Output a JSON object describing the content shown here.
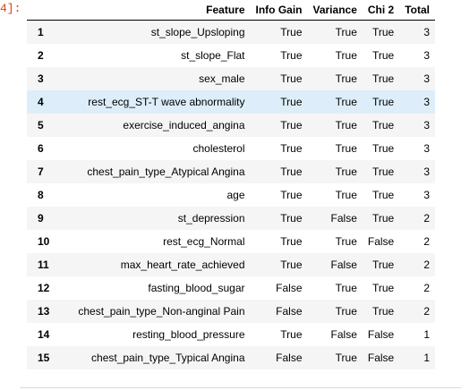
{
  "cell": {
    "prompt": "4]:"
  },
  "table": {
    "columns": [
      "",
      "Feature",
      "Info Gain",
      "Variance",
      "Chi 2",
      "Total"
    ],
    "rows": [
      {
        "index": "1",
        "feature": "st_slope_Upsloping",
        "info_gain": "True",
        "variance": "True",
        "chi2": "True",
        "total": "3"
      },
      {
        "index": "2",
        "feature": "st_slope_Flat",
        "info_gain": "True",
        "variance": "True",
        "chi2": "True",
        "total": "3"
      },
      {
        "index": "3",
        "feature": "sex_male",
        "info_gain": "True",
        "variance": "True",
        "chi2": "True",
        "total": "3"
      },
      {
        "index": "4",
        "feature": "rest_ecg_ST-T wave abnormality",
        "info_gain": "True",
        "variance": "True",
        "chi2": "True",
        "total": "3"
      },
      {
        "index": "5",
        "feature": "exercise_induced_angina",
        "info_gain": "True",
        "variance": "True",
        "chi2": "True",
        "total": "3"
      },
      {
        "index": "6",
        "feature": "cholesterol",
        "info_gain": "True",
        "variance": "True",
        "chi2": "True",
        "total": "3"
      },
      {
        "index": "7",
        "feature": "chest_pain_type_Atypical Angina",
        "info_gain": "True",
        "variance": "True",
        "chi2": "True",
        "total": "3"
      },
      {
        "index": "8",
        "feature": "age",
        "info_gain": "True",
        "variance": "True",
        "chi2": "True",
        "total": "3"
      },
      {
        "index": "9",
        "feature": "st_depression",
        "info_gain": "True",
        "variance": "False",
        "chi2": "True",
        "total": "2"
      },
      {
        "index": "10",
        "feature": "rest_ecg_Normal",
        "info_gain": "True",
        "variance": "True",
        "chi2": "False",
        "total": "2"
      },
      {
        "index": "11",
        "feature": "max_heart_rate_achieved",
        "info_gain": "True",
        "variance": "False",
        "chi2": "True",
        "total": "2"
      },
      {
        "index": "12",
        "feature": "fasting_blood_sugar",
        "info_gain": "False",
        "variance": "True",
        "chi2": "True",
        "total": "2"
      },
      {
        "index": "13",
        "feature": "chest_pain_type_Non-anginal Pain",
        "info_gain": "False",
        "variance": "True",
        "chi2": "True",
        "total": "2"
      },
      {
        "index": "14",
        "feature": "resting_blood_pressure",
        "info_gain": "True",
        "variance": "False",
        "chi2": "False",
        "total": "1"
      },
      {
        "index": "15",
        "feature": "chest_pain_type_Typical Angina",
        "info_gain": "False",
        "variance": "True",
        "chi2": "False",
        "total": "1"
      }
    ],
    "highlighted_row": 3,
    "colors": {
      "hover_row": "#ddeefa",
      "stripe": "#f5f5f5",
      "prompt": "#d84315"
    }
  }
}
